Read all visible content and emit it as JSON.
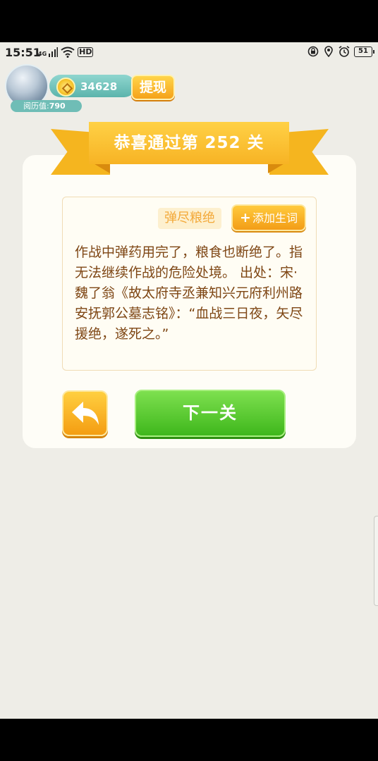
{
  "status_bar": {
    "time": "15:51",
    "network_label": "4G",
    "hd_label": "HD",
    "battery": "51"
  },
  "header": {
    "coins": "34628",
    "withdraw_label": "提现",
    "experience_label": "阅历值:",
    "experience_value": "790"
  },
  "banner": {
    "title": "恭喜通过第 252 关"
  },
  "result": {
    "idiom": "弹尽粮绝",
    "add_word_label": "添加生词",
    "definition": "作战中弹药用完了，粮食也断绝了。指无法继续作战的危险处境。 出处：宋·魏了翁《故太府寺丞兼知兴元府利州路安抚郭公墓志铭》：“血战三日夜，矢尽援绝，遂死之。”"
  },
  "actions": {
    "next_label": "下一关"
  },
  "colors": {
    "banner": "#f7b324",
    "next_button": "#3fb71c",
    "definition_text": "#7e4614",
    "background": "#eeede7"
  }
}
